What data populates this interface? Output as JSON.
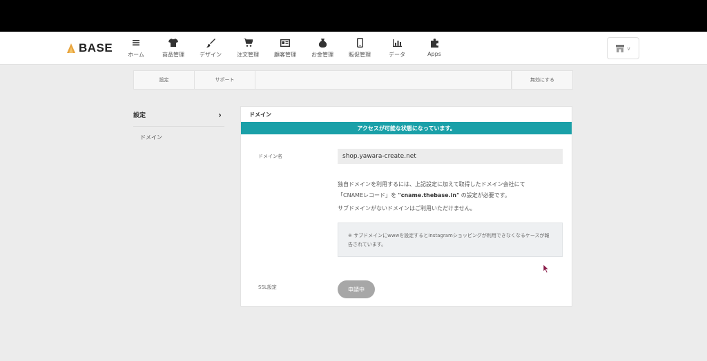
{
  "header": {
    "logo_text": "BASE",
    "nav": [
      {
        "label": "ホーム",
        "icon": "menu-icon"
      },
      {
        "label": "商品管理",
        "icon": "shirt-icon"
      },
      {
        "label": "デザイン",
        "icon": "brush-icon"
      },
      {
        "label": "注文管理",
        "icon": "cart-icon"
      },
      {
        "label": "顧客管理",
        "icon": "customer-card-icon"
      },
      {
        "label": "お金管理",
        "icon": "money-bag-icon"
      },
      {
        "label": "販促管理",
        "icon": "smartphone-icon"
      },
      {
        "label": "データ",
        "icon": "bar-chart-icon"
      },
      {
        "label": "Apps",
        "icon": "puzzle-icon"
      }
    ],
    "shop_switcher_icon": "shop-icon"
  },
  "subtabs": {
    "settings": "設定",
    "support": "サポート",
    "disable": "無効にする"
  },
  "sidebar": {
    "heading": "設定",
    "items": [
      "ドメイン"
    ]
  },
  "panel": {
    "title": "ドメイン",
    "alert": "アクセスが可能な状態になっています。",
    "domain_label": "ドメイン名",
    "domain_value": "shop.yawara-create.net",
    "desc_line1": "独自ドメインを利用するには、上記設定に加えて取得したドメイン会社にて",
    "desc_line2_pre": "「CNAMEレコード」を ",
    "desc_line2_bold": "\"cname.thebase.in\"",
    "desc_line2_post": " の設定が必要です。",
    "desc_sub": "サブドメインがないドメインはご利用いただけません。",
    "note": "※ サブドメインにwwwを設定するとInstagramショッピングが利用できなくなるケースが報告されています。",
    "ssl_label": "SSL設定",
    "ssl_status": "申請中"
  },
  "colors": {
    "accent": "#1aa0a8",
    "ssl_button": "#a7a7a7",
    "background": "#ececec"
  }
}
